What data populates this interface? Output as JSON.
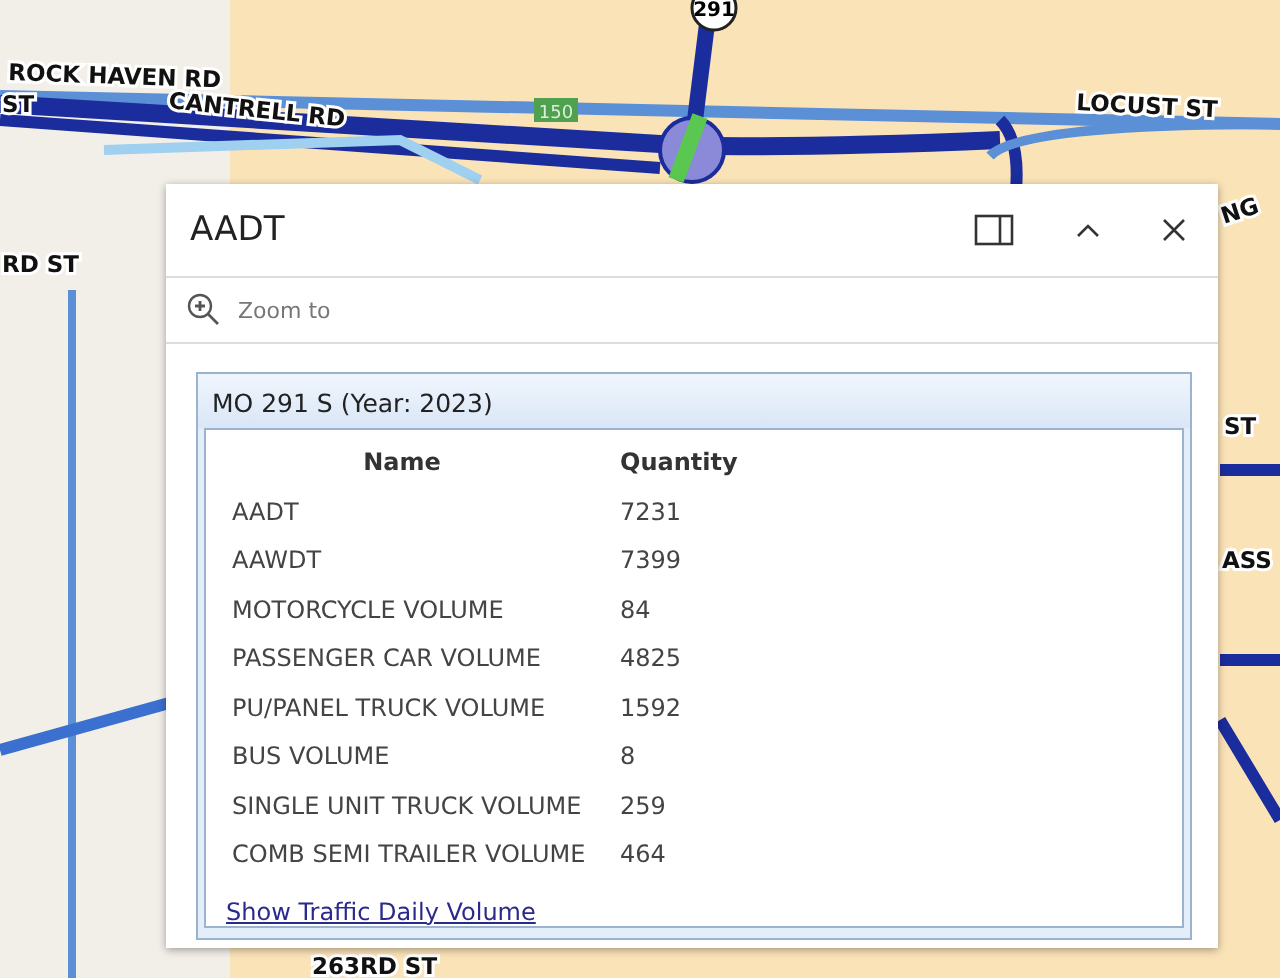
{
  "map": {
    "labels": [
      "ROCK HAVEN RD",
      "ST",
      "CANTRELL RD",
      "LOCUST ST",
      "RD ST",
      "NG",
      "ST",
      "ASS",
      "263RD ST"
    ],
    "shields": [
      "291",
      "150"
    ]
  },
  "popup": {
    "title": "AADT",
    "zoom_action": "Zoom to",
    "section": {
      "title": "MO 291 S (Year: 2023)",
      "columns": [
        "Name",
        "Quantity"
      ],
      "rows": [
        [
          "AADT",
          "7231"
        ],
        [
          "AAWDT",
          "7399"
        ],
        [
          "MOTORCYCLE VOLUME",
          "84"
        ],
        [
          "PASSENGER CAR VOLUME",
          "4825"
        ],
        [
          "PU/PANEL TRUCK VOLUME",
          "1592"
        ],
        [
          "BUS VOLUME",
          "8"
        ],
        [
          "SINGLE UNIT TRUCK VOLUME",
          "259"
        ],
        [
          "COMB SEMI TRAILER VOLUME",
          "464"
        ]
      ],
      "link": "Show Traffic Daily Volume"
    }
  }
}
